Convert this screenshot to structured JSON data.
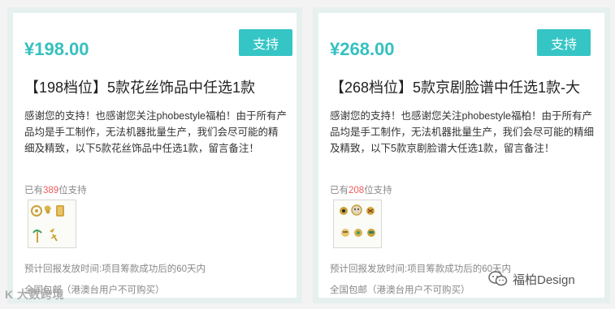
{
  "cards": [
    {
      "price": "¥198.00",
      "button_label": "支持",
      "title": "【198档位】5款花丝饰品中任选1款",
      "description": "感谢您的支持！也感谢您关注phobestyle福柏！由于所有产品均是手工制作，无法机器批量生产，我们会尽可能的精细及精致，以下5款花丝饰品中任选1款，留言备注！",
      "backers_prefix": "已有",
      "backers_count": "389",
      "backers_suffix": "位支持",
      "reward_time": "预计回报发放时间:项目筹款成功后的60天内",
      "shipping": "全国包邮（港澳台用户不可购买）"
    },
    {
      "price": "¥268.00",
      "button_label": "支持",
      "title": "【268档位】5款京剧脸谱中任选1款-大",
      "description": "感谢您的支持！也感谢您关注phobestyle福柏！由于所有产品均是手工制作，无法机器批量生产，我们会尽可能的精细及精致，以下5款京剧脸谱大任选1款，留言备注！",
      "backers_prefix": "已有",
      "backers_count": "208",
      "backers_suffix": "位支持",
      "reward_time": "预计回报发放时间:项目筹款成功后的60天内",
      "shipping": "全国包邮（港澳台用户不可购买）"
    }
  ],
  "watermark_left": "K 大数跨境",
  "watermark_right": "福柏Design",
  "colors": {
    "accent": "#36c5c5",
    "price": "#36c0c0",
    "backers_count": "#f05a5a",
    "card_border": "#e6f0ef"
  }
}
